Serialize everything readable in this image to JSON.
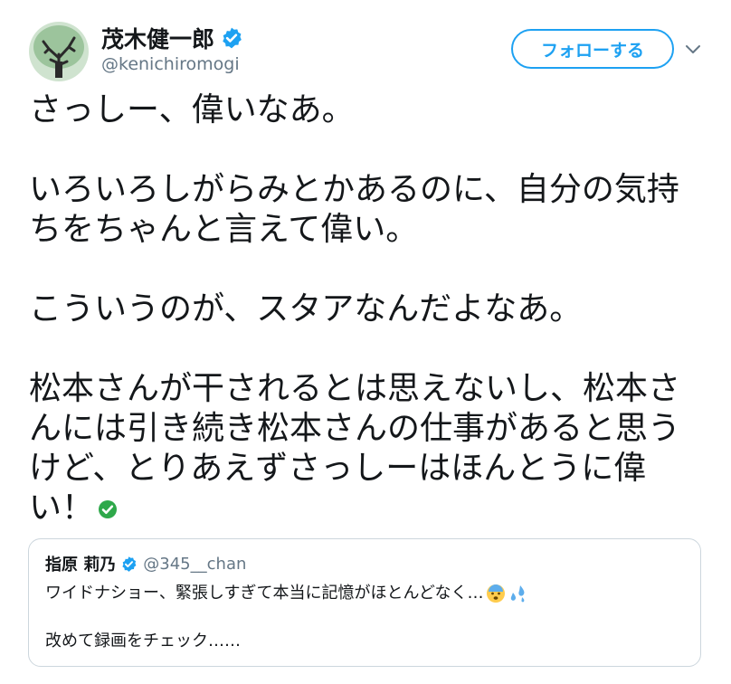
{
  "author": {
    "name": "茂木健一郎",
    "handle": "@kenichiromogi"
  },
  "actions": {
    "follow_label": "フォローする"
  },
  "tweet": {
    "lines": [
      "さっしー、偉いなあ。",
      "いろいろしがらみとかあるのに、自分の気持",
      "ちをちゃんと言えて偉い。",
      "こういうのが、スタアなんだよなあ。",
      "松本さんが干されるとは思えないし、松本さ",
      "んには引き続き松本さんの仕事があると思う",
      "けど、とりあえずさっしーはほんとうに偉",
      "い！"
    ]
  },
  "quoted": {
    "name": "指原 莉乃",
    "handle": "@345__chan",
    "text_line1": "ワイドナショー、緊張しすぎて本当に記憶がほとんどなく…",
    "text_line2": "改めて録画をチェック……"
  },
  "colors": {
    "accent": "#1da1f2",
    "text": "#14171a",
    "muted": "#657786",
    "border": "#ccd6dd"
  }
}
